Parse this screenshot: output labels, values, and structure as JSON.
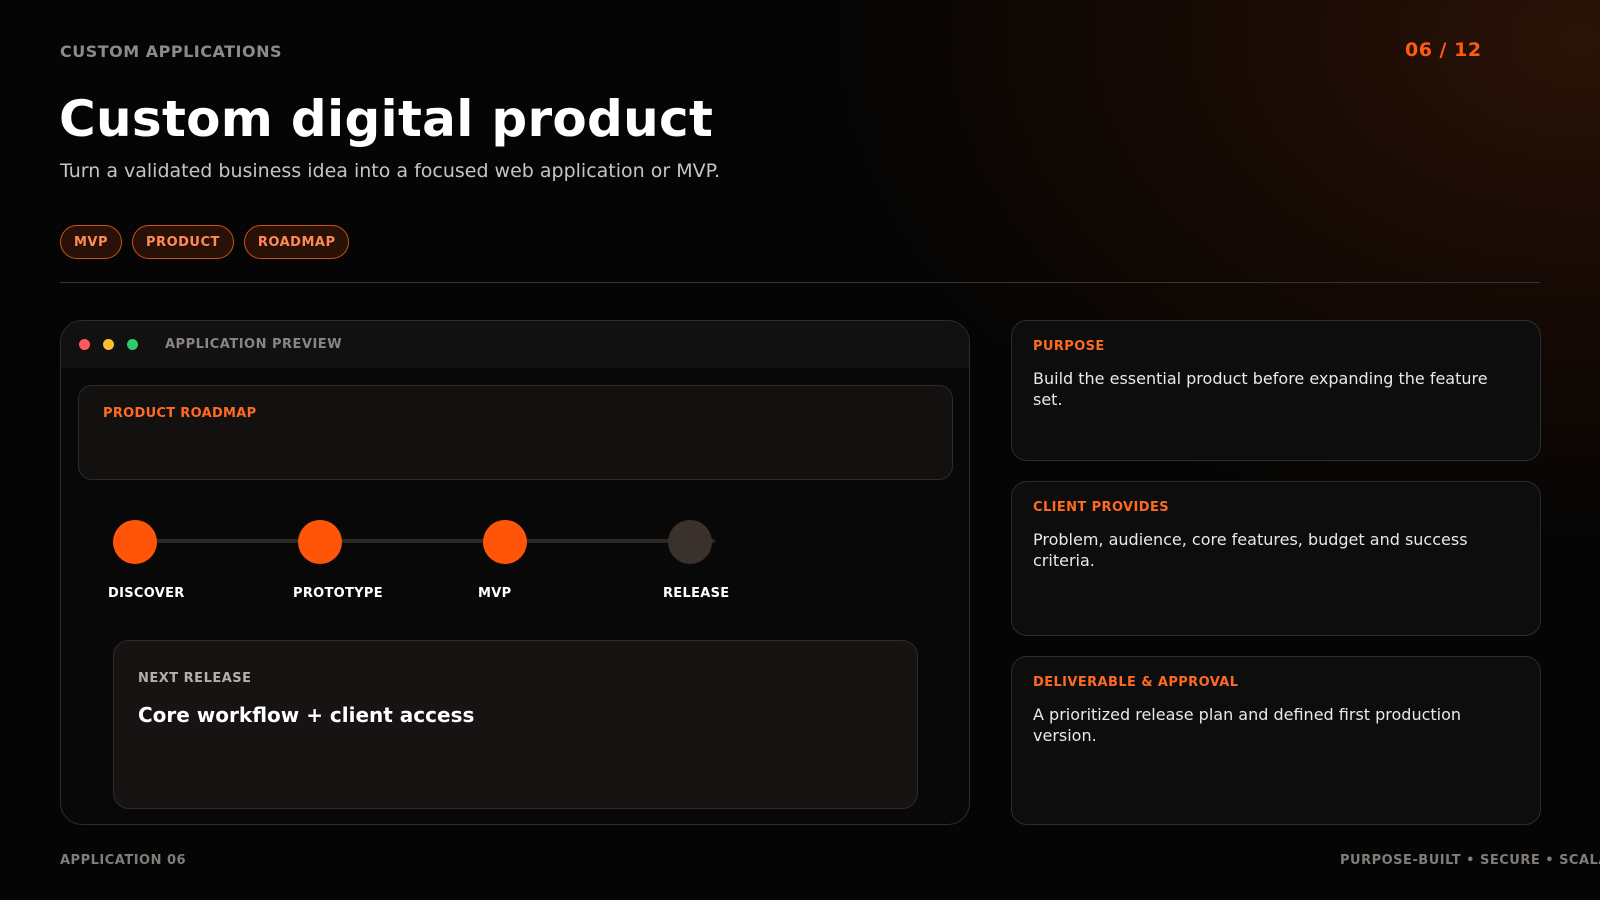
{
  "header": {
    "eyebrow": "CUSTOM APPLICATIONS",
    "pager": "06 / 12",
    "title": "Custom digital product",
    "subtitle": "Turn a validated business idea into a focused web application or MVP."
  },
  "tags": [
    "MVP",
    "PRODUCT",
    "ROADMAP"
  ],
  "app_preview": {
    "window_label": "APPLICATION PREVIEW",
    "roadmap_label": "PRODUCT ROADMAP",
    "steps": [
      {
        "label": "DISCOVER",
        "status": "complete"
      },
      {
        "label": "PROTOTYPE",
        "status": "complete"
      },
      {
        "label": "MVP",
        "status": "complete"
      },
      {
        "label": "RELEASE",
        "status": "pending"
      }
    ],
    "next_release_label": "NEXT RELEASE",
    "next_release_value": "Core workflow + client access"
  },
  "info_cards": [
    {
      "label": "PURPOSE",
      "text": "Build the essential product before expanding the feature set."
    },
    {
      "label": "CLIENT PROVIDES",
      "text": "Problem, audience, core features, budget and success criteria."
    },
    {
      "label": "DELIVERABLE & APPROVAL",
      "text": "A prioritized release plan and defined first production version."
    }
  ],
  "footer": {
    "left": "APPLICATION 06",
    "right": "PURPOSE-BUILT • SECURE • SCALABLE"
  },
  "colors": {
    "accent": "#ff5508",
    "pending_step": "#3b312c",
    "background": "#050505"
  }
}
